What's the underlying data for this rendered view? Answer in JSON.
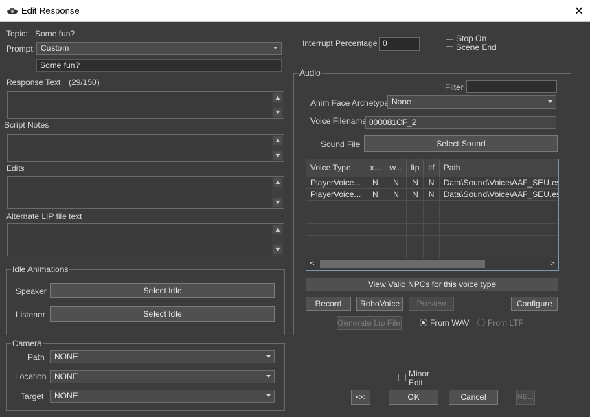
{
  "window": {
    "title": "Edit Response",
    "close_glyph": "✕"
  },
  "left": {
    "topic_label": "Topic:",
    "topic_value": "Some fun?",
    "prompt_label": "Prompt:",
    "prompt_selected": "Custom",
    "prompt_text": "Some fun?",
    "response_text_label": "Response Text",
    "response_count": "(29/150)",
    "script_notes_label": "Script Notes",
    "edits_label": "Edits",
    "alt_lip_label": "Alternate LIP file text",
    "idle": {
      "group_label": "Idle Animations",
      "speaker_label": "Speaker",
      "speaker_button": "Select Idle",
      "listener_label": "Listener",
      "listener_button": "Select Idle"
    },
    "camera": {
      "group_label": "Camera",
      "path_label": "Path",
      "path_value": "NONE",
      "location_label": "Location",
      "location_value": "NONE",
      "target_label": "Target",
      "target_value": "NONE"
    }
  },
  "right": {
    "interrupt_label": "Interrupt Percentage",
    "interrupt_value": "0",
    "stop_on_scene_end": {
      "line1": "Stop On",
      "line2": "Scene End",
      "checked": false
    },
    "audio": {
      "group_label": "Audio",
      "filter_label": "Filter",
      "filter_value": "",
      "anim_face_label": "Anim Face Archetype",
      "anim_face_value": "None",
      "voice_filename_label": "Voice Filename",
      "voice_filename_value": "000081CF_2",
      "sound_file_label": "Sound File",
      "select_sound_button": "Select Sound",
      "columns": [
        "Voice Type",
        "x...",
        "w...",
        "lip",
        "ltf",
        "Path"
      ],
      "rows": [
        [
          "PlayerVoice...",
          "N",
          "N",
          "N",
          "N",
          "Data\\Sound\\Voice\\AAF_SEU.esp"
        ],
        [
          "PlayerVoice...",
          "N",
          "N",
          "N",
          "N",
          "Data\\Sound\\Voice\\AAF_SEU.esp"
        ]
      ],
      "view_npcs_button": "View Valid NPCs for this voice type",
      "record_button": "Record",
      "robovoice_button": "RoboVoice",
      "preview_button": "Preview",
      "configure_button": "Configure",
      "generate_lip_button": "Generate Lip File:",
      "from_wav_label": "From WAV",
      "from_ltf_label": "From LTF",
      "lip_source_selected": "From WAV"
    }
  },
  "bottom": {
    "minor_edit": {
      "line1": "Minor",
      "line2": "Edit",
      "checked": false
    },
    "prev_button": "<<",
    "ok_button": "OK",
    "cancel_button": "Cancel",
    "next_button": "NE..."
  }
}
